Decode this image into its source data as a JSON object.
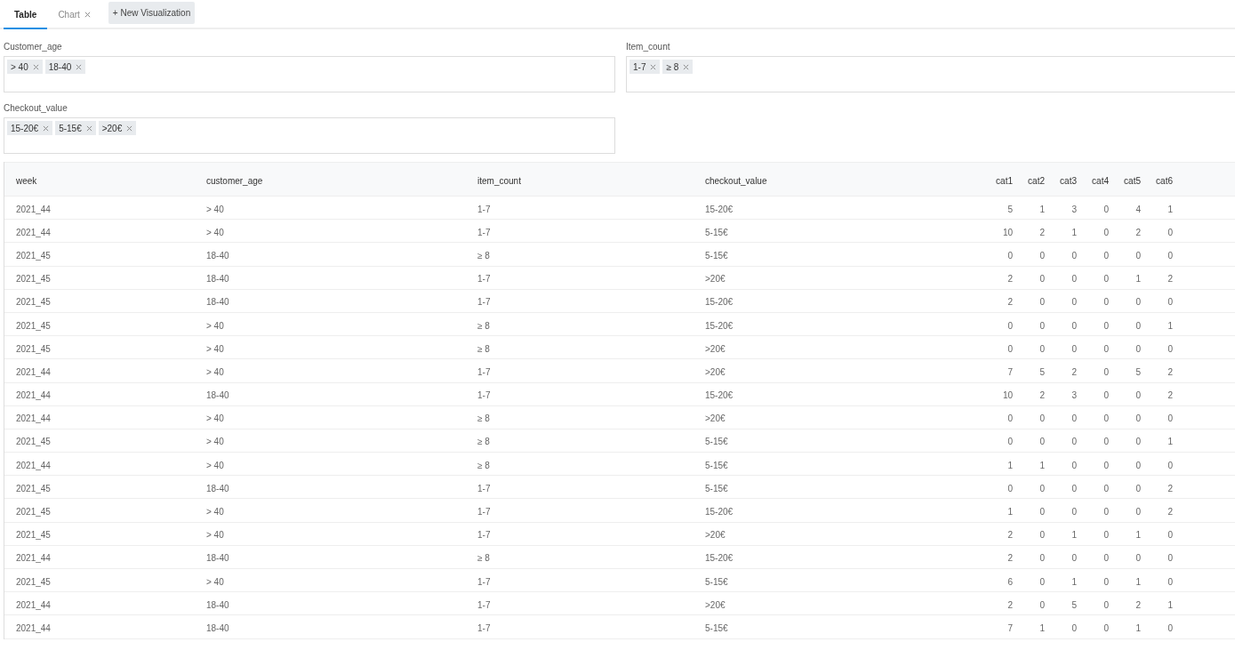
{
  "tabs": [
    {
      "label": "Table",
      "selected": true,
      "closable": false
    },
    {
      "label": "Chart",
      "selected": false,
      "closable": true
    }
  ],
  "new_button": "+ New Visualization",
  "filters": [
    {
      "label": "Customer_age",
      "tags": [
        "> 40",
        "18-40"
      ]
    },
    {
      "label": "Item_count",
      "tags": [
        "1-7",
        "≥ 8"
      ]
    },
    {
      "label": "Checkout_value",
      "tags": [
        "15-20€",
        "5-15€",
        ">20€"
      ]
    }
  ],
  "table": {
    "columns": [
      "week",
      "customer_age",
      "item_count",
      "checkout_value",
      "cat1",
      "cat2",
      "cat3",
      "cat4",
      "cat5",
      "cat6"
    ],
    "rows": [
      [
        "2021_44",
        "> 40",
        "1-7",
        "15-20€",
        "5",
        "1",
        "3",
        "0",
        "4",
        "1"
      ],
      [
        "2021_44",
        "> 40",
        "1-7",
        "5-15€",
        "10",
        "2",
        "1",
        "0",
        "2",
        "0"
      ],
      [
        "2021_45",
        "18-40",
        "≥ 8",
        "5-15€",
        "0",
        "0",
        "0",
        "0",
        "0",
        "0"
      ],
      [
        "2021_45",
        "18-40",
        "1-7",
        ">20€",
        "2",
        "0",
        "0",
        "0",
        "1",
        "2"
      ],
      [
        "2021_45",
        "18-40",
        "1-7",
        "15-20€",
        "2",
        "0",
        "0",
        "0",
        "0",
        "0"
      ],
      [
        "2021_45",
        "> 40",
        "≥ 8",
        "15-20€",
        "0",
        "0",
        "0",
        "0",
        "0",
        "1"
      ],
      [
        "2021_45",
        "> 40",
        "≥ 8",
        ">20€",
        "0",
        "0",
        "0",
        "0",
        "0",
        "0"
      ],
      [
        "2021_44",
        "> 40",
        "1-7",
        ">20€",
        "7",
        "5",
        "2",
        "0",
        "5",
        "2"
      ],
      [
        "2021_44",
        "18-40",
        "1-7",
        "15-20€",
        "10",
        "2",
        "3",
        "0",
        "0",
        "2"
      ],
      [
        "2021_44",
        "> 40",
        "≥ 8",
        ">20€",
        "0",
        "0",
        "0",
        "0",
        "0",
        "0"
      ],
      [
        "2021_45",
        "> 40",
        "≥ 8",
        "5-15€",
        "0",
        "0",
        "0",
        "0",
        "0",
        "1"
      ],
      [
        "2021_44",
        "> 40",
        "≥ 8",
        "5-15€",
        "1",
        "1",
        "0",
        "0",
        "0",
        "0"
      ],
      [
        "2021_45",
        "18-40",
        "1-7",
        "5-15€",
        "0",
        "0",
        "0",
        "0",
        "0",
        "2"
      ],
      [
        "2021_45",
        "> 40",
        "1-7",
        "15-20€",
        "1",
        "0",
        "0",
        "0",
        "0",
        "2"
      ],
      [
        "2021_45",
        "> 40",
        "1-7",
        ">20€",
        "2",
        "0",
        "1",
        "0",
        "1",
        "0"
      ],
      [
        "2021_44",
        "18-40",
        "≥ 8",
        "15-20€",
        "2",
        "0",
        "0",
        "0",
        "0",
        "0"
      ],
      [
        "2021_45",
        "> 40",
        "1-7",
        "5-15€",
        "6",
        "0",
        "1",
        "0",
        "1",
        "0"
      ],
      [
        "2021_44",
        "18-40",
        "1-7",
        ">20€",
        "2",
        "0",
        "5",
        "0",
        "2",
        "1"
      ],
      [
        "2021_44",
        "18-40",
        "1-7",
        "5-15€",
        "7",
        "1",
        "0",
        "0",
        "1",
        "0"
      ]
    ]
  }
}
